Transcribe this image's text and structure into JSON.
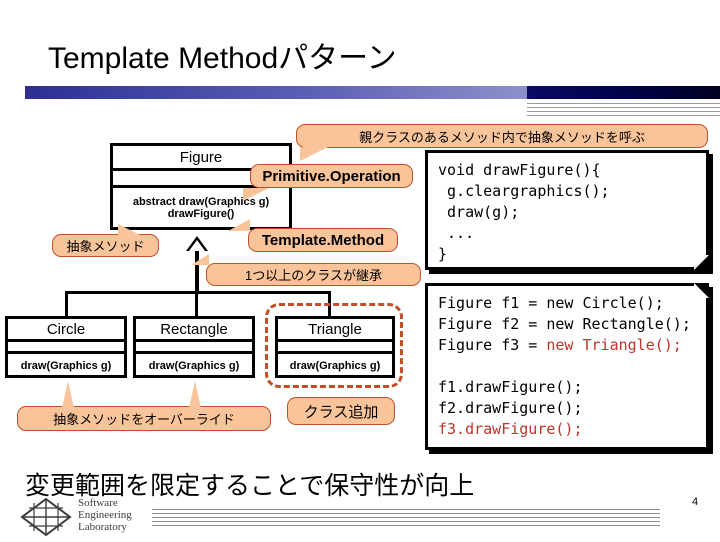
{
  "slide": {
    "title": "Template Methodパターン",
    "bottom_message": "変更範囲を限定することで保守性が向上",
    "page_number": "4"
  },
  "logo": {
    "line1": "Software",
    "line2": "Engineering",
    "line3": "Laboratory"
  },
  "uml": {
    "parent": {
      "name": "Figure",
      "attributes": "",
      "operations": [
        "abstract draw(Graphics g)",
        "drawFigure()"
      ]
    },
    "children": [
      {
        "name": "Circle",
        "operation": "draw(Graphics g)",
        "highlighted": false
      },
      {
        "name": "Rectangle",
        "operation": "draw(Graphics g)",
        "highlighted": false
      },
      {
        "name": "Triangle",
        "operation": "draw(Graphics g)",
        "highlighted": true
      }
    ]
  },
  "callouts": {
    "call_abstract_in_parent": "親クラスのあるメソッド内で抽象メソッドを呼ぶ",
    "primitive_operation": "Primitive.Operation",
    "abstract_method": "抽象メソッド",
    "template_method": "Template.Method",
    "one_or_more_subclasses": "1つ以上のクラスが継承",
    "override_abstract_method": "抽象メソッドをオーバーライド",
    "class_added": "クラス追加"
  },
  "code": {
    "template": {
      "lines": [
        "void drawFigure(){",
        " g.cleargraphics();",
        " draw(g);",
        " ...",
        "}"
      ]
    },
    "client": {
      "line1_plain": "Figure f1 = new Circle();",
      "line2_plain": "Figure f2 = new Rectangle();",
      "line3_prefix": "Figure f3 = ",
      "line3_highlight": "new Triangle();",
      "line5_plain": "f1.drawFigure();",
      "line6_plain": "f2.drawFigure();",
      "line7_highlight": "f3.drawFigure();"
    }
  },
  "colors": {
    "callout_fill": "#F9C49A",
    "callout_border": "#C0502A",
    "highlight_red": "#C0332B",
    "bar_navy": "#000046",
    "bar_gradient_start": "#2D2F91"
  }
}
